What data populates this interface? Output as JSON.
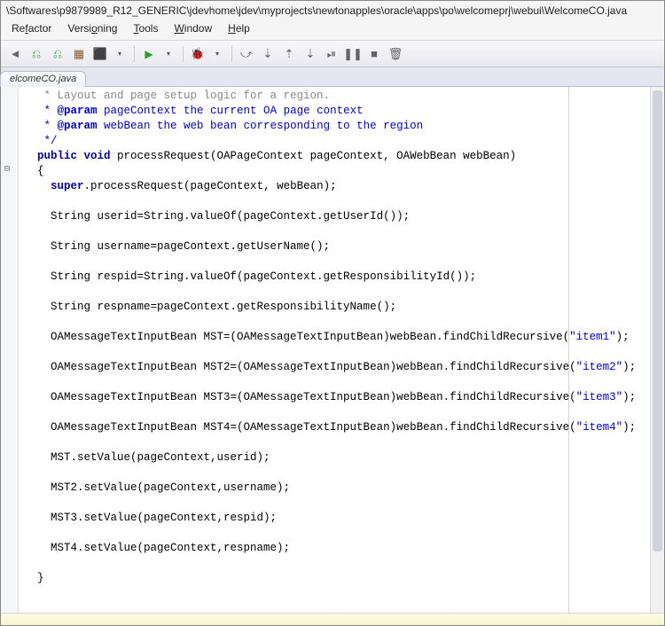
{
  "title_path": "\\Softwares\\p9879989_R12_GENERIC\\jdevhome\\jdev\\myprojects\\newtonapples\\oracle\\apps\\po\\welcomeprj\\webui\\WelcomeCO.java",
  "menus": {
    "refactor": {
      "pre": "Re",
      "u": "f",
      "post": "actor"
    },
    "versioning": {
      "pre": "Versi",
      "u": "o",
      "post": "ning"
    },
    "tools": {
      "pre": "",
      "u": "T",
      "post": "ools"
    },
    "window": {
      "pre": "",
      "u": "W",
      "post": "indow"
    },
    "help": {
      "pre": "",
      "u": "H",
      "post": "elp"
    }
  },
  "toolbar": {
    "pointer": "◄",
    "bin1": "⎌",
    "bin2": "⎌",
    "jig": "▦",
    "bug_sm": "⬛",
    "drop": "▾",
    "run": "▶",
    "debug": "🐞",
    "step_over": "⤻",
    "step_into": "⇣",
    "step_out": "⇡",
    "resume": "⏯",
    "pause": "❚❚",
    "stop": "■",
    "trash": "🗑"
  },
  "tab": {
    "label": "elcomeCO.java"
  },
  "code": {
    "l01": "   * Layout and page setup logic for a region.",
    "l02a": "   * ",
    "l02b": "@param",
    "l02c": " pageContext the current OA page context",
    "l03a": "   * ",
    "l03b": "@param",
    "l03c": " webBean the web bean corresponding to the region",
    "l04": "   */",
    "l05a": "  ",
    "l05b": "public void",
    "l05c": " processRequest(OAPageContext pageContext, OAWebBean webBean)",
    "l06": "  {",
    "l07a": "    ",
    "l07b": "super",
    "l07c": ".processRequest(pageContext, webBean);",
    "l08": "",
    "l09": "    String userid=String.valueOf(pageContext.getUserId());",
    "l10": "",
    "l11": "    String username=pageContext.getUserName();",
    "l12": "",
    "l13": "    String respid=String.valueOf(pageContext.getResponsibilityId());",
    "l14": "",
    "l15": "    String respname=pageContext.getResponsibilityName();",
    "l16": "",
    "l17a": "    OAMessageTextInputBean MST=(OAMessageTextInputBean)webBean.findChildRecursive(",
    "l17b": "\"item1\"",
    "l17c": ");",
    "l18": "",
    "l19a": "    OAMessageTextInputBean MST2=(OAMessageTextInputBean)webBean.findChildRecursive(",
    "l19b": "\"item2\"",
    "l19c": ");",
    "l20": "",
    "l21a": "    OAMessageTextInputBean MST3=(OAMessageTextInputBean)webBean.findChildRecursive(",
    "l21b": "\"item3\"",
    "l21c": ");",
    "l22": "",
    "l23a": "    OAMessageTextInputBean MST4=(OAMessageTextInputBean)webBean.findChildRecursive(",
    "l23b": "\"item4\"",
    "l23c": ");",
    "l24": "",
    "l25": "    MST.setValue(pageContext,userid);",
    "l26": "",
    "l27": "    MST2.setValue(pageContext,username);",
    "l28": "",
    "l29": "    MST3.setValue(pageContext,respid);",
    "l30": "",
    "l31": "    MST4.setValue(pageContext,respname);",
    "l32": "",
    "l33": "  }"
  },
  "gutter": {
    "collapse": "⊟"
  }
}
